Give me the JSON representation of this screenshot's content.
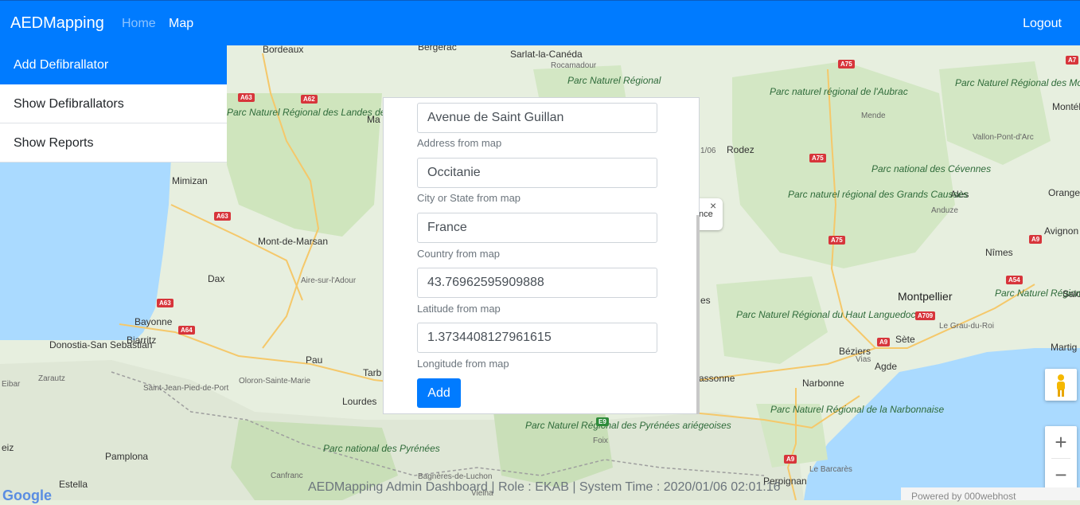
{
  "navbar": {
    "brand": "AEDMapping",
    "home": "Home",
    "map": "Map",
    "logout": "Logout"
  },
  "sidebar": {
    "items": [
      {
        "label": "Add Defibrallator",
        "active": true
      },
      {
        "label": "Show Defibrallators",
        "active": false
      },
      {
        "label": "Show Reports",
        "active": false
      }
    ]
  },
  "form": {
    "address_value": "Avenue de Saint Guillan",
    "address_help": "Address from map",
    "city_value": "Occitanie",
    "city_help": "City or State from map",
    "country_value": "France",
    "country_help": "Country from map",
    "latitude_value": "43.76962595909888",
    "latitude_help": "Latitude from map",
    "longitude_value": "1.3734408127961615",
    "longitude_help": "Longitude from map",
    "add_label": "Add"
  },
  "infowindow": {
    "text": "nce",
    "close": "×"
  },
  "map": {
    "places": [
      "Bordeaux",
      "Bergerac",
      "Sarlat-la-Canéda",
      "Rocamadour",
      "Parc Naturel Régional",
      "Mimizan",
      "Parc Naturel Régional des Landes de Gascogne",
      "Mont-de-Marsan",
      "Dax",
      "Aire-sur-l'Adour",
      "Bayonne",
      "Biarritz",
      "Donostia-San Sebastián",
      "Zarautz",
      "Eibar",
      "Saint-Jean-Pied-de-Port",
      "Oloron-Sainte-Marie",
      "Pau",
      "Tarb",
      "Lourdes",
      "Parc national des Pyrénées",
      "Pamplona",
      "Estella",
      "Canfranc",
      "Bagnères-de-Luchon",
      "Vielha",
      "Rodez",
      "Mende",
      "Parc naturel régional de l'Aubrac",
      "Parc Naturel Régional des Monts d'Ardèche",
      "Montélima",
      "Vallon-Pont-d'Arc",
      "Parc national des Cévennes",
      "Alès",
      "Orange",
      "Anduze",
      "Parc naturel régional des Grands Causses",
      "Avignon",
      "Nîmes",
      "Montpellier",
      "Parc Naturel Régional de Camargue",
      "Le Grau-du-Roi",
      "Salon",
      "Parc Naturel Régional du Haut Languedoc",
      "Béziers",
      "Sète",
      "Agde",
      "Vias",
      "Martig",
      "Narbonne",
      "Parc Naturel Régional de la Narbonnaise",
      "Le Barcarès",
      "Perpignan",
      "Foix",
      "Parc Naturel Régional des Pyrénées ariégeoises",
      "assonne",
      "es",
      "Ma",
      "eiz",
      "1/06"
    ],
    "roads": [
      "A63",
      "A62",
      "A63",
      "A63",
      "A64",
      "A75",
      "A75",
      "A75",
      "A7",
      "A9",
      "A54",
      "A709",
      "A9",
      "A9",
      "E9"
    ]
  },
  "map_controls": {
    "pegman_icon": "pegman-icon",
    "zoom_in": "+",
    "zoom_out": "−"
  },
  "footer": {
    "text": "AEDMapping Admin Dashboard | Role : EKAB | System Time : 2020/01/06 02:01:16"
  },
  "attribution": {
    "google": "Google",
    "powered": "Powered by  000webhost"
  }
}
